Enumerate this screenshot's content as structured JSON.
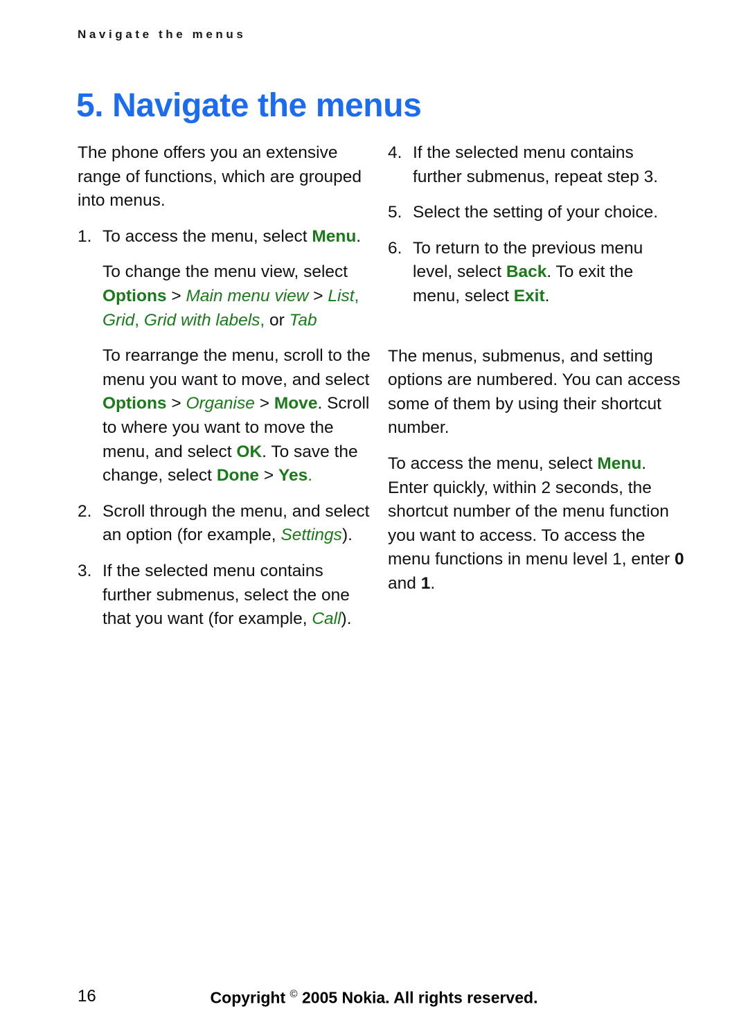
{
  "running_header": "Navigate the menus",
  "chapter_title": "5. Navigate the menus",
  "colors": {
    "title_blue": "#1b6cf0",
    "emphasis_green": "#1a7a1a",
    "body_black": "#111111"
  },
  "left_column": {
    "intro": "The phone offers you an extensive range of functions, which are grouped into menus.",
    "item1": {
      "number": "1.",
      "line_a_pre": "To access the menu, select ",
      "line_a_emph": "Menu",
      "line_a_post": ".",
      "line_b_pre": "To change the menu view, select ",
      "opt_options": "Options",
      "arrow1": " > ",
      "opt_main_menu_view": "Main menu view",
      "arrow2": " > ",
      "opt_list": "List",
      "sep1": ", ",
      "opt_grid": "Grid",
      "sep2": ", ",
      "opt_grid_with_labels": "Grid with labels",
      "sep3": ",",
      "or_text": " or ",
      "opt_tab": "Tab",
      "line_c_pre": "To rearrange the menu, scroll to the menu you want to move, and select ",
      "c_options": "Options",
      "c_arrow1": " > ",
      "c_organise": "Organise",
      "c_arrow2": " > ",
      "c_move": "Move",
      "c_mid": ". Scroll to where you want to move the menu, and select ",
      "c_ok": "OK",
      "c_after_ok": ". To save the change, select ",
      "c_done": "Done",
      "c_arrow3": " > ",
      "c_yes": "Yes",
      "c_end": "."
    },
    "item2": {
      "number": "2.",
      "pre": "Scroll through the menu, and select an option (for example, ",
      "emph": "Settings",
      "post": ")."
    },
    "item3": {
      "number": "3.",
      "pre": "If the selected menu contains further submenus, select the one that you want (for example, ",
      "emph": "Call",
      "post": ")."
    }
  },
  "right_column": {
    "item4": {
      "number": "4.",
      "text": "If the selected menu contains further submenus, repeat step 3."
    },
    "item5": {
      "number": "5.",
      "text": "Select the setting of your choice."
    },
    "item6": {
      "number": "6.",
      "pre": "To return to the previous menu level, select ",
      "emph_back": "Back",
      "mid": ". To exit the menu, select ",
      "emph_exit": "Exit",
      "post": "."
    },
    "para_numbered": "The menus, submenus, and setting options are numbered. You can access some of them by using their shortcut number.",
    "para_shortcut": {
      "pre": "To access the menu, select ",
      "emph_menu": "Menu",
      "mid": ". Enter quickly, within 2 seconds, the shortcut number of the menu function you want to access. To access the menu functions in menu level 1, enter ",
      "key_zero": "0",
      "and_text": " and ",
      "key_one": "1",
      "post": "."
    }
  },
  "footer": {
    "page_number": "16",
    "copyright_pre": "Copyright ",
    "copyright_symbol": "©",
    "copyright_post": " 2005 Nokia. All rights reserved."
  }
}
